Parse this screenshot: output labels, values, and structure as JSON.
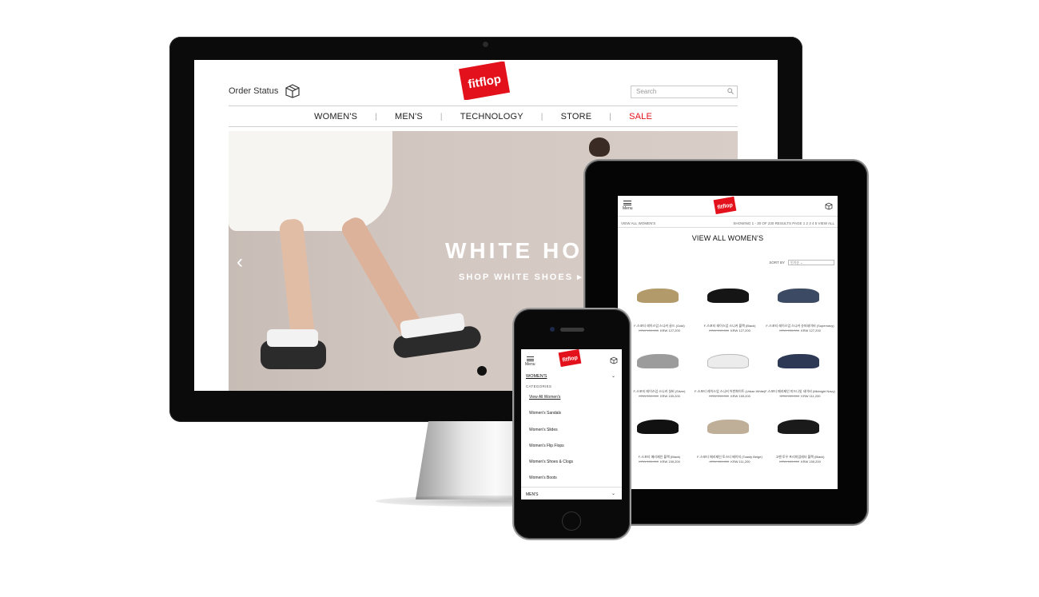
{
  "brand": {
    "logo_text": "fitflop",
    "logo_color": "#e3111b"
  },
  "desktop": {
    "order_status": "Order Status",
    "search_placeholder": "Search",
    "nav": [
      {
        "label": "WOMEN'S"
      },
      {
        "label": "MEN'S"
      },
      {
        "label": "TECHNOLOGY"
      },
      {
        "label": "STORE"
      },
      {
        "label": "SALE"
      }
    ],
    "hero": {
      "title": "WHITE HO",
      "link": "SHOP WHITE SHOES ▸"
    }
  },
  "tablet": {
    "menu_label": "Menu",
    "breadcrumb": "VIEW ALL WOMEN'S",
    "results": "SHOWING 1 - 30 OF 230 RESULTS    PAGE  1  2  3  4  5  VIEW ALL",
    "page_title": "VIEW ALL WOMEN'S",
    "sort_label": "SORT BY",
    "sort_value": "인기순 ⌄",
    "products": [
      {
        "name": "F-스포티 레이스업 스니커 골드 (Gold)",
        "old": "KRW 159,000",
        "price": "KRW 127,200",
        "color": "#b39a6a"
      },
      {
        "name": "F-스포티 레이스업 스니커 블랙 (Black)",
        "old": "KRW 159,000",
        "price": "KRW 127,200",
        "color": "#151515"
      },
      {
        "name": "F-스포티 레이스업 스니커 슈퍼네이비 (Supernavy)",
        "old": "KRW 159,000",
        "price": "KRW 127,200",
        "color": "#3d4a63"
      },
      {
        "name": "F-스포티 레이스업 스니커 실버 (Silver)",
        "old": "KRW 159,000",
        "price": "KRW 159,200",
        "color": "#9c9c9c"
      },
      {
        "name": "F-스포티 레이스업 스니커 어반화이트 (Urban White)",
        "old": "KRW 159,000",
        "price": "KRW 159,200",
        "color": "#ececec"
      },
      {
        "name": "F-스포티 메리제인 미드나잇 네이비 (Midnight Navy)",
        "old": "KRW 139,000",
        "price": "KRW 111,200",
        "color": "#2e3a55"
      },
      {
        "name": "F-스포티 메리제인 블랙 (Black)",
        "old": "KRW 139,000",
        "price": "KRW 159,200",
        "color": "#111111"
      },
      {
        "name": "F-스포티 메리제인 토스티 베이지 (Toasty Beige)",
        "old": "KRW 139,000",
        "price": "KRW 111,200",
        "color": "#bfae98"
      },
      {
        "name": "고젠 토우 프리미엄레더 블랙 (Black)",
        "old": "KRW 189,000",
        "price": "KRW 159,200",
        "color": "#1a1a1a"
      }
    ]
  },
  "phone": {
    "menu_label": "Menu",
    "women": "WOMEN'S",
    "categories_label": "CATEGORIES",
    "items": [
      "View All Women's",
      "Women's Sandals",
      "Women's Slides",
      "Women's Flip Flops",
      "Women's Shoes & Clogs",
      "Women's Boots"
    ],
    "men": "MEN'S"
  }
}
